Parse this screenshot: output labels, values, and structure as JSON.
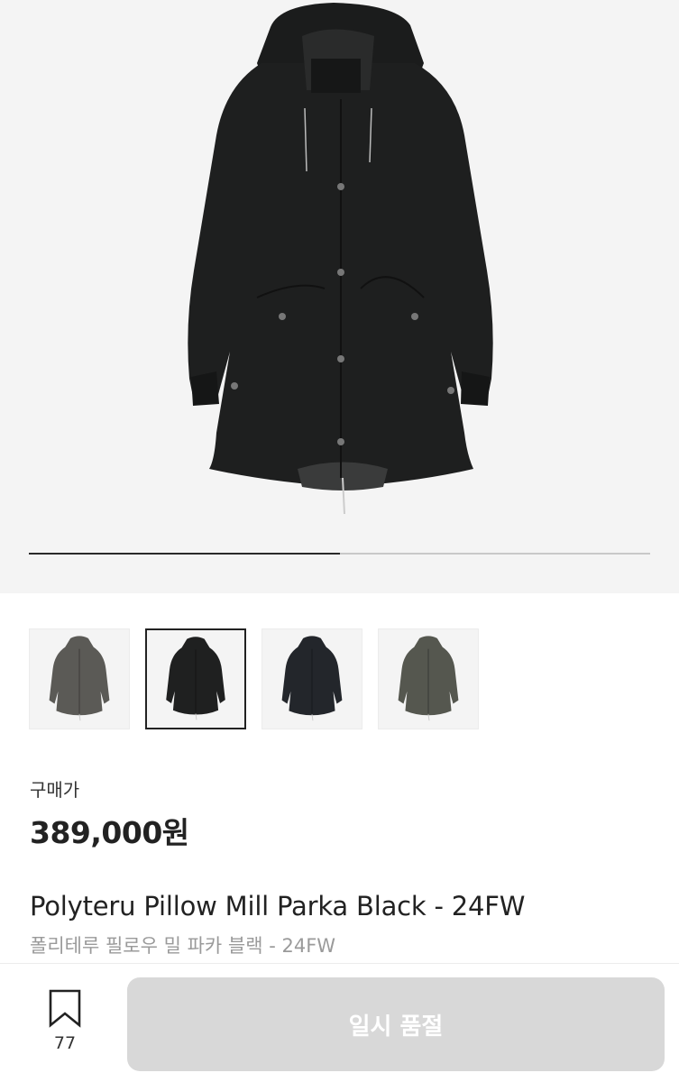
{
  "gallery": {
    "main_image": "black-parka-photo",
    "progress": 0.5,
    "thumbnails": [
      {
        "label": "charcoal-parka-thumb",
        "color": "#5b5a56",
        "active": false
      },
      {
        "label": "black-parka-thumb",
        "color": "#1f2020",
        "active": true
      },
      {
        "label": "navy-black-parka-thumb",
        "color": "#23262b",
        "active": false
      },
      {
        "label": "olive-grey-parka-thumb",
        "color": "#55574f",
        "active": false
      }
    ]
  },
  "product": {
    "price_label": "구매가",
    "price": "389,000원",
    "name_en": "Polyteru Pillow Mill Parka Black - 24FW",
    "name_ko": "폴리테루 필로우 밀 파카 블랙 - 24FW"
  },
  "actions": {
    "bookmark_icon": "bookmark-icon",
    "bookmark_count": "77",
    "soldout_label": "일시 품절"
  },
  "colors": {
    "coat": "#1e1f1f",
    "background": "#f4f4f4",
    "button_disabled": "#d8d8d8"
  }
}
